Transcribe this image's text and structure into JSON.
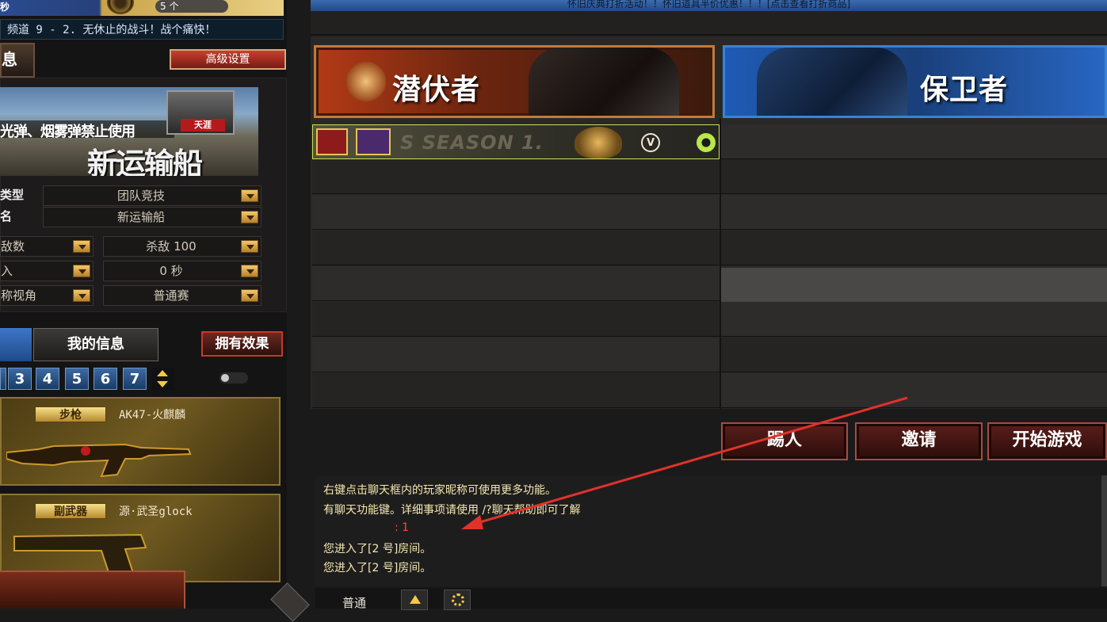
{
  "header": {
    "clock_suffix": "秒",
    "count_label": "5 个",
    "notice": "怀旧庆典打折活动！！怀旧道具半价优惠！！！[点击查看打折商品]"
  },
  "channel_text": "频道 9 - 2. 无休止的战斗！战个痛快！",
  "left": {
    "info_tab": "息",
    "advanced_button": "高级设置",
    "map": {
      "warning": "光弹、烟雾弹禁止使用",
      "name": "新运输船",
      "badge": "天涯"
    },
    "settings": [
      {
        "label": "类型",
        "value": "团队竞技"
      },
      {
        "label": "名",
        "value": "新运输船"
      }
    ],
    "options": [
      {
        "left_label": "敌数",
        "right_value": "杀敌 100"
      },
      {
        "left_label": "入",
        "right_value": "0 秒"
      },
      {
        "left_label": "称视角",
        "right_value": "普通赛"
      }
    ],
    "my_info_tab": "我的信息",
    "effect_button": "拥有效果",
    "slots": [
      "3",
      "4",
      "5",
      "6",
      "7"
    ],
    "weapons": [
      {
        "category": "步枪",
        "name": "AK47-火麒麟"
      },
      {
        "category": "副武器",
        "name": "源·武圣glock"
      }
    ]
  },
  "teams": {
    "red": "潜伏者",
    "blue": "保卫者"
  },
  "player_row": {
    "season_text": "S SEASON 1.",
    "v_badge": "V"
  },
  "actions": {
    "kick": "踢人",
    "invite": "邀请",
    "start": "开始游戏"
  },
  "chat": {
    "lines": [
      "右键点击聊天框内的玩家昵称可使用更多功能。",
      "有聊天功能键。详细事项请使用 /?聊天帮助即可了解",
      ": 1",
      "您进入了[2 号]房间。",
      "您进入了[2 号]房间。"
    ],
    "mode": "普通"
  },
  "colors": {
    "accent_red": "#c7402f",
    "chat_text": "#f3e7b0",
    "chat_highlight": "#ff4a3a",
    "gold": "#f5c64a"
  }
}
